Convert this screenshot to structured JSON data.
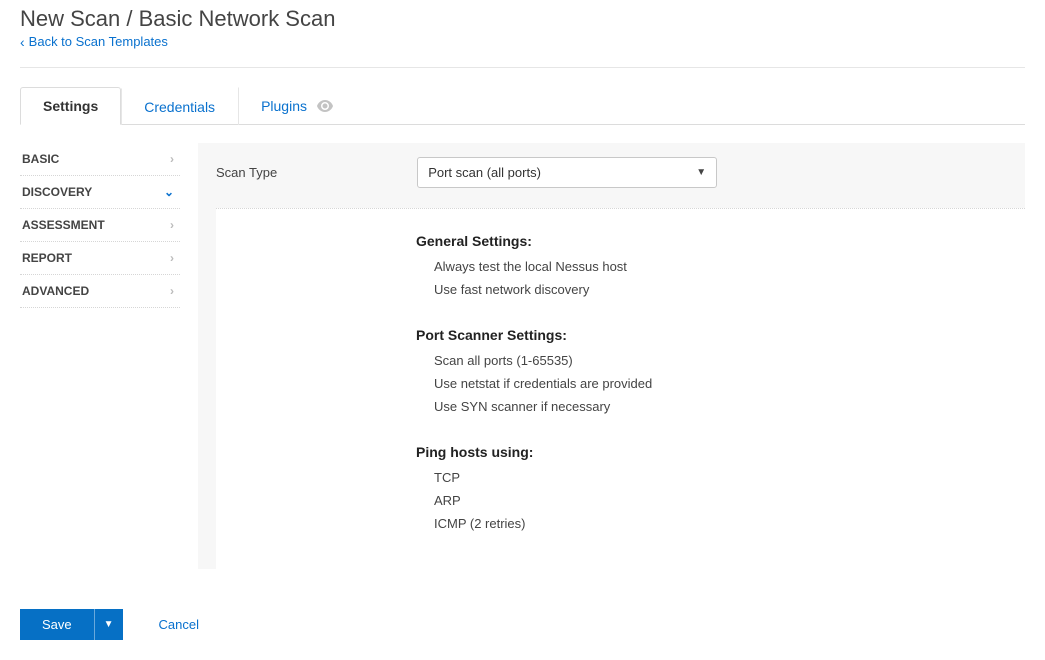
{
  "header": {
    "title": "New Scan / Basic Network Scan",
    "back_label": "Back to Scan Templates"
  },
  "tabs": [
    {
      "label": "Settings",
      "active": true
    },
    {
      "label": "Credentials",
      "active": false
    },
    {
      "label": "Plugins",
      "active": false,
      "eye": true
    }
  ],
  "sidebar": {
    "items": [
      {
        "label": "BASIC",
        "state": "collapsed"
      },
      {
        "label": "DISCOVERY",
        "state": "expanded"
      },
      {
        "label": "ASSESSMENT",
        "state": "collapsed"
      },
      {
        "label": "REPORT",
        "state": "collapsed"
      },
      {
        "label": "ADVANCED",
        "state": "collapsed"
      }
    ]
  },
  "form": {
    "scan_type_label": "Scan Type",
    "scan_type_value": "Port scan (all ports)"
  },
  "sections": [
    {
      "heading": "General Settings:",
      "items": [
        "Always test the local Nessus host",
        "Use fast network discovery"
      ]
    },
    {
      "heading": "Port Scanner Settings:",
      "items": [
        "Scan all ports (1-65535)",
        "Use netstat if credentials are provided",
        "Use SYN scanner if necessary"
      ]
    },
    {
      "heading": "Ping hosts using:",
      "items": [
        "TCP",
        "ARP",
        "ICMP (2 retries)"
      ]
    }
  ],
  "footer": {
    "save_label": "Save",
    "cancel_label": "Cancel"
  }
}
